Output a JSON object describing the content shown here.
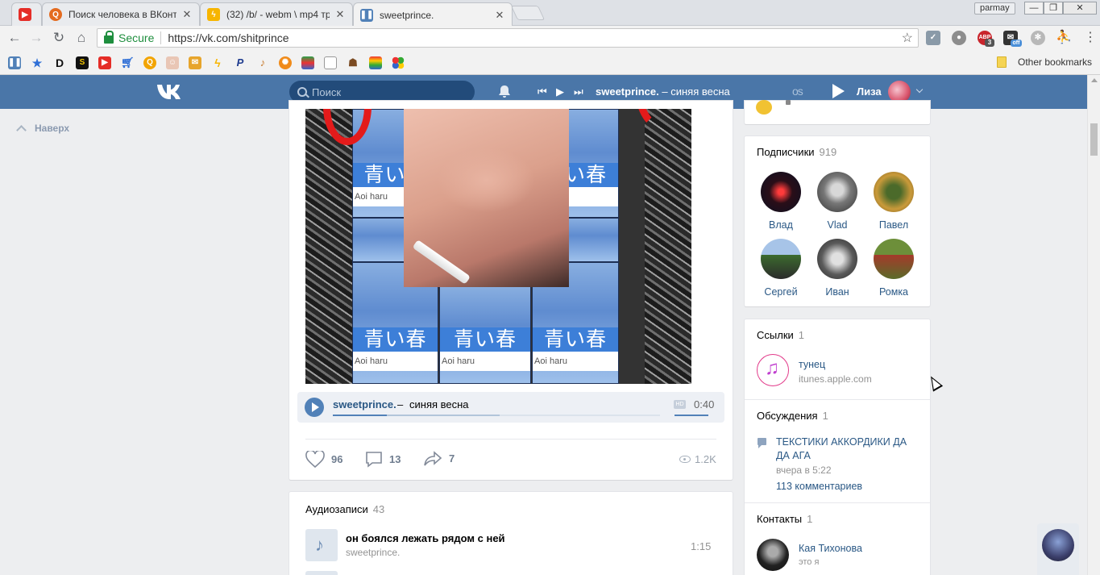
{
  "browser": {
    "tabs": [
      {
        "title": "",
        "favicon": "youtube-icon",
        "color": "#e52d27"
      },
      {
        "title": "Поиск человека в ВКонт",
        "favicon": "search-engine-icon",
        "color": "#e46b1f"
      },
      {
        "title": "(32) /b/ - webm \\ mp4 тр",
        "favicon": "bolt-icon",
        "color": "#f7b500"
      },
      {
        "title": "sweetprince.",
        "favicon": "pause-icon",
        "color": "#5181b8"
      }
    ],
    "profile_name": "parmay",
    "window_controls": {
      "minimize": "—",
      "restore": "❐",
      "close": "✕"
    },
    "secure_label": "Secure",
    "url": "https://vk.com/shitprince",
    "bookmarks_other": "Other bookmarks",
    "extension_badges": {
      "abp": "ABP",
      "abp_count": "3",
      "off": "off"
    }
  },
  "vk_header": {
    "search_placeholder": "Поиск",
    "now_playing": {
      "artist": "sweetprince.",
      "dash": " – ",
      "title": "синяя весна"
    },
    "os_label": "os",
    "user_name": "Лиза"
  },
  "left": {
    "back_to_top": "Наверх"
  },
  "post": {
    "image_texts": {
      "kanji": "青い春",
      "romaji": "Aoi haru"
    },
    "audio": {
      "artist": "sweetprince.",
      "separator": "–",
      "title": "синяя весна",
      "hd": "HD",
      "duration": "0:40",
      "progress": 0.165,
      "buffered": 0.51
    },
    "likes": "96",
    "comments": "13",
    "shares": "7",
    "views": "1.2K"
  },
  "audios": {
    "title": "Аудиозаписи",
    "count": "43",
    "items": [
      {
        "title": "он боялся лежать рядом с ней",
        "artist": "sweetprince.",
        "duration": "1:15"
      }
    ]
  },
  "subscribers": {
    "title": "Подписчики",
    "count": "919",
    "items": [
      {
        "name": "Влад"
      },
      {
        "name": "Vlad"
      },
      {
        "name": "Павел"
      },
      {
        "name": "Сергей"
      },
      {
        "name": "Иван"
      },
      {
        "name": "Ромка"
      }
    ]
  },
  "links": {
    "title": "Ссылки",
    "count": "1",
    "items": [
      {
        "title": "тунец",
        "subtitle": "itunes.apple.com"
      }
    ]
  },
  "discussions": {
    "title": "Обсуждения",
    "count": "1",
    "items": [
      {
        "title": "ТЕКСТИКИ АККОРДИКИ ДА ДА АГА",
        "date": "вчера в 5:22",
        "comments": "113 комментариев"
      }
    ]
  },
  "contacts": {
    "title": "Контакты",
    "count": "1",
    "items": [
      {
        "name": "Кая Тихонова",
        "subtitle": "это я"
      }
    ]
  },
  "colors": {
    "vk_blue": "#4a76a8",
    "link": "#2a5885",
    "secondary": "#939393",
    "background": "#edeef0"
  }
}
